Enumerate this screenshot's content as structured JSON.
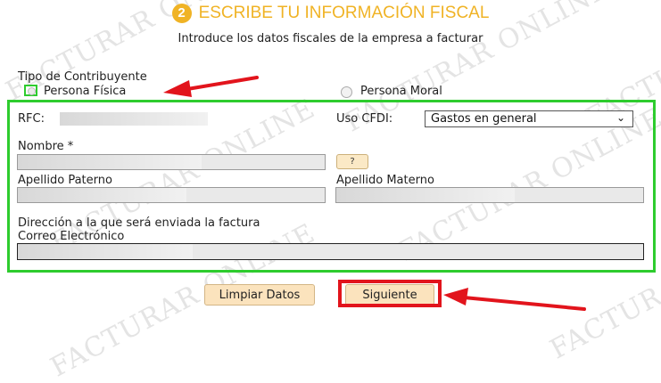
{
  "header": {
    "step_number": "2",
    "title": "ESCRIBE TU INFORMACIÓN FISCAL",
    "subtitle": "Introduce los datos fiscales de la empresa a facturar"
  },
  "watermark": {
    "text": "FACTURAR ONLINE"
  },
  "contribuyente": {
    "label": "Tipo de Contribuyente",
    "options": [
      {
        "label": "Persona Física",
        "selected": false
      },
      {
        "label": "Persona Moral",
        "selected": false
      }
    ]
  },
  "form": {
    "rfc_label": "RFC:",
    "uso_cfdi_label": "Uso CFDI:",
    "uso_cfdi_value": "Gastos en general",
    "nombre_label": "Nombre *",
    "help_button": "?",
    "apellido_paterno_label": "Apellido Paterno",
    "apellido_materno_label": "Apellido Materno",
    "direccion_label": "Dirección a la que será enviada la factura",
    "correo_label": "Correo Electrónico"
  },
  "actions": {
    "limpiar_label": "Limpiar Datos",
    "siguiente_label": "Siguiente"
  },
  "colors": {
    "accent": "#f0b325",
    "highlight_green": "#2ecc2e",
    "annotation_red": "#e2141c",
    "button_bg": "#fbe3bd"
  }
}
